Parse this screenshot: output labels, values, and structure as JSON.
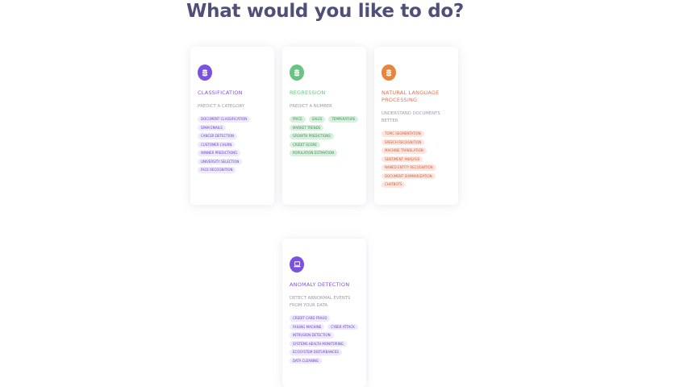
{
  "page": {
    "title": "What would you like to do?"
  },
  "colors": {
    "title": "#4f4f79",
    "purple": "#7b52e0",
    "purple_tag_bg": "#efe9fd",
    "green": "#6ac283",
    "green_tag_bg": "#d8f1de",
    "orange": "#e8853a",
    "nlp_title": "#e0714f",
    "orange_tag_bg": "#fde6df"
  },
  "cards": {
    "classification": {
      "icon": "database-icon",
      "title": "CLASSIFICATION",
      "subtitle": "PREDICT A CATEGORY",
      "tags": [
        "DOCUMENT CLASSIFICATION",
        "SPAM EMAILS",
        "CANCER DETECTION",
        "CUSTOMER CHURN",
        "WINNER PREDICTIONS",
        "UNIVERSITY SELECTION",
        "FACE RECOGNITION"
      ]
    },
    "regression": {
      "icon": "database-icon",
      "title": "REGRESSION",
      "subtitle": "PREDICT A NUMBER",
      "tags": [
        "PRICE",
        "SALES",
        "TEMPERATURE",
        "MARKET TRENDS",
        "GROWTH PREDICTIONS",
        "CREDIT SCORE",
        "POPULATION ESTIMATION"
      ]
    },
    "nlp": {
      "icon": "database-icon",
      "title": "NATURAL LANGUAGE PROCESSING",
      "subtitle": "UNDERSTAND DOCUMENTS BETTER",
      "tags": [
        "TOPIC SEGMENTATION",
        "SPEECH RECOGNITION",
        "MACHINE TRANSLATION",
        "SENTIMENT ANALYSIS",
        "NAMED ENTITY RECOGNITION",
        "DOCUMENT SUMMARIZATION",
        "CHATBOTS"
      ]
    },
    "anomaly": {
      "icon": "laptop-icon",
      "title": "ANOMALY DETECTION",
      "subtitle": "DETECT ABNORMAL EVENTS FROM YOUR DATA",
      "tags": [
        "CREDIT CARD FRAUD",
        "FAILING MACHINE",
        "CYBER ATTACK",
        "INTRUSION DETECTION",
        "SYSTEMS HEALTH MONITORING",
        "ECOSYSTEM DISTURBANCES",
        "DATA CLEANING"
      ]
    }
  }
}
